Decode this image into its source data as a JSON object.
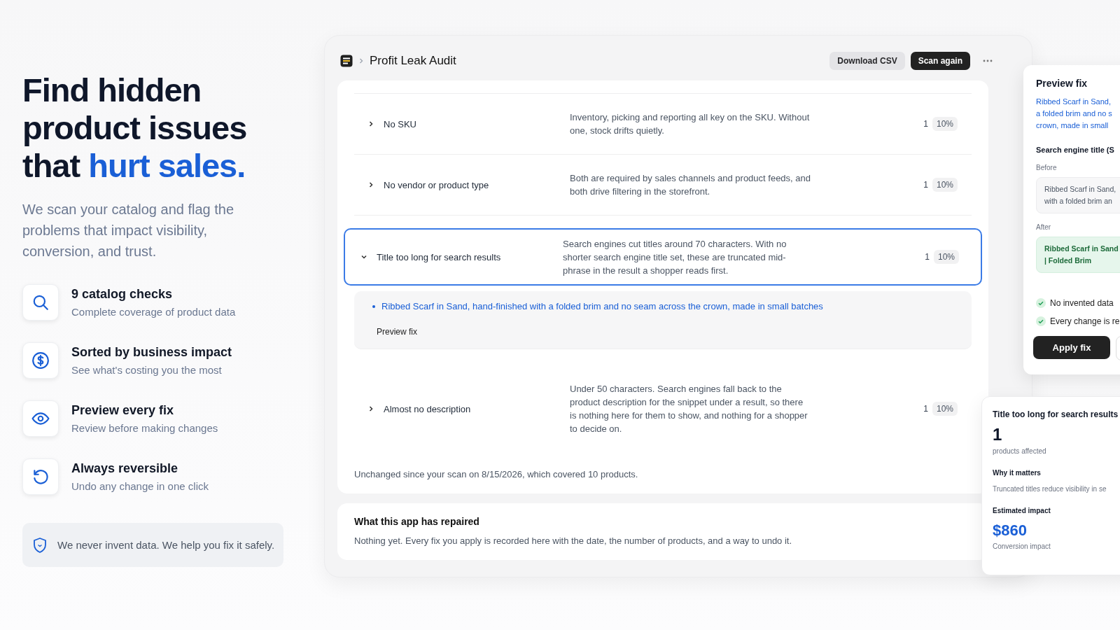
{
  "hero": {
    "headline": "Find hidden product issues that",
    "headline_highlight": "hurt sales.",
    "subtitle": "We scan your catalog and flag the problems that impact visibility, conversion, and trust.",
    "features": [
      {
        "kind": "search",
        "title": "9 catalog checks",
        "subtitle": "Complete coverage of product data"
      },
      {
        "kind": "dollar",
        "title": "Sorted by business impact",
        "subtitle": "See what's costing you the most"
      },
      {
        "kind": "eye",
        "title": "Preview every fix",
        "subtitle": "Review before making changes"
      },
      {
        "kind": "undo",
        "title": "Always reversible",
        "subtitle": "Undo any change in one click"
      }
    ],
    "note": "We never invent data. We help you fix it safely."
  },
  "app": {
    "title": "Profit Leak Audit",
    "actions": [
      {
        "label": "Download CSV",
        "kind": "secondary"
      },
      {
        "label": "Scan again",
        "kind": "primary"
      }
    ],
    "checks": [
      {
        "title": "No SKU",
        "description": "Inventory, picking and reporting all key on the SKU. Without one, stock drifts quietly.",
        "count": "1",
        "share": "10%",
        "expanded": false
      },
      {
        "title": "No vendor or product type",
        "description": "Both are required by sales channels and product feeds, and both drive filtering in the storefront.",
        "count": "1",
        "share": "10%",
        "expanded": false
      },
      {
        "title": "Title too long for search results",
        "description": "Search engines cut titles around 70 characters. With no shorter search engine title set, these are truncated mid-phrase in the result a shopper reads first.",
        "count": "1",
        "share": "10%",
        "expanded": true,
        "products": [
          "Ribbed Scarf in Sand, hand-finished with a folded brim and no seam across the crown, made in small batches"
        ],
        "action": "Preview fix"
      },
      {
        "title": "Almost no description",
        "description": "Under 50 characters. Search engines fall back to the product description for the snippet under a result, so there is nothing here for them to show, and nothing for a shopper to decide on.",
        "count": "1",
        "share": "10%",
        "expanded": false
      }
    ],
    "scan_note": "Unchanged since your scan on 8/15/2026, which covered 10 products.",
    "repaired": {
      "title": "What this app has repaired",
      "text": "Nothing yet. Every fix you apply is recorded here with the date, the number of products, and a way to undo it."
    }
  },
  "preview": {
    "title": "Preview fix",
    "product_lines": [
      "Ribbed Scarf in Sand,",
      "a folded brim and no s",
      "crown, made in small"
    ],
    "field": "Search engine title (S",
    "before_label": "Before",
    "before_lines": [
      "Ribbed Scarf in Sand,",
      "with a folded brim an"
    ],
    "after_label": "After",
    "after_lines": [
      "Ribbed Scarf in Sand",
      "| Folded Brim"
    ],
    "assurances": [
      "No invented data",
      "Every change is re"
    ],
    "apply": "Apply fix"
  },
  "impact": {
    "title": "Title too long for search results",
    "count": "1",
    "count_label": "products affected",
    "why_label": "Why it matters",
    "why": "Truncated titles reduce visibility in se",
    "estimate_label": "Estimated impact",
    "estimate": "$860",
    "estimate_note": "Conversion impact"
  }
}
